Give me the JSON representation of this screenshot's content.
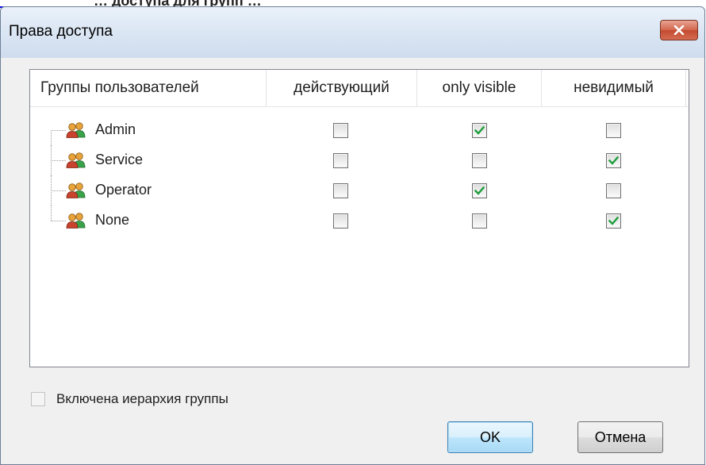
{
  "background": {
    "link_color": "#0000ee",
    "text_fragment": "… доступа для групп …"
  },
  "dialog": {
    "title": "Права доступа",
    "close_icon": "close-x-icon"
  },
  "table": {
    "columns": [
      "Группы пользователей",
      "действующий",
      "only visible",
      "невидимый"
    ],
    "rows": [
      {
        "name": "Admin",
        "icon": "user-group-icon",
        "checks": [
          false,
          true,
          false
        ]
      },
      {
        "name": "Service",
        "icon": "user-group-icon",
        "checks": [
          false,
          false,
          true
        ]
      },
      {
        "name": "Operator",
        "icon": "user-group-icon",
        "checks": [
          false,
          true,
          false
        ]
      },
      {
        "name": "None",
        "icon": "user-group-icon",
        "checks": [
          false,
          false,
          true
        ]
      }
    ]
  },
  "hierarchy": {
    "label": "Включена иерархия группы",
    "checked": false,
    "enabled": false
  },
  "buttons": {
    "ok": "OK",
    "cancel": "Отмена"
  },
  "colors": {
    "check_green": "#1e9e3c",
    "close_red": "#c9543a",
    "ok_border": "#3c7fb1"
  }
}
